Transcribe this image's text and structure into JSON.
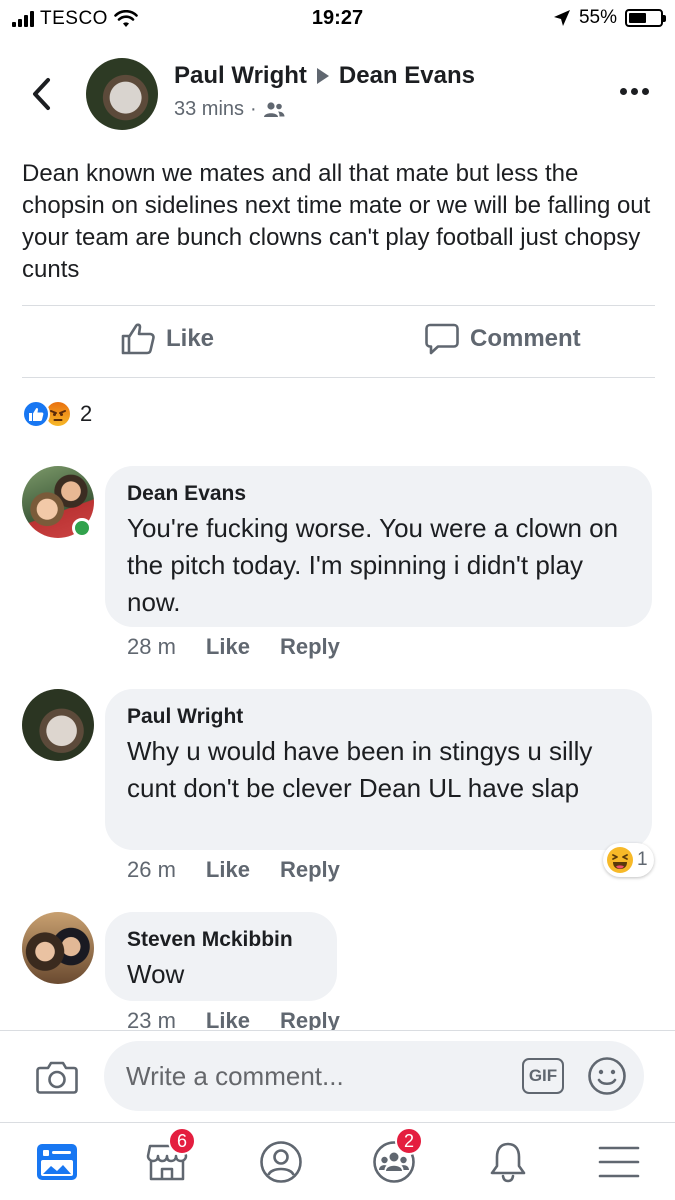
{
  "status_bar": {
    "carrier": "TESCO",
    "time": "19:27",
    "battery_percent": "55%",
    "battery_level": 0.55
  },
  "post": {
    "author": "Paul Wright",
    "target": "Dean Evans",
    "time": "33 mins",
    "separator": "·",
    "audience_icon": "friends-icon",
    "text": "Dean known we mates and all that mate but less the chopsin on sidelines next time mate or we will be falling out your team are bunch clowns can't play football just chopsy cunts",
    "like_label": "Like",
    "comment_label": "Comment",
    "reaction_count": "2",
    "reaction_icons": [
      "like-reaction-icon",
      "angry-reaction-icon"
    ]
  },
  "comments": [
    {
      "author": "Dean Evans",
      "text": "You're fucking worse. You were a clown on the pitch today. I'm spinning i didn't play now.",
      "time": "28 m",
      "like": "Like",
      "reply": "Reply",
      "online": true
    },
    {
      "author": "Paul Wright",
      "text": "Why u would have been in stingys u silly cunt don't be clever Dean UL have slap",
      "time": "26 m",
      "like": "Like",
      "reply": "Reply",
      "reaction_count": "1",
      "reaction_icon": "haha-reaction-icon"
    },
    {
      "author": "Steven Mckibbin",
      "text": "Wow",
      "time": "23 m",
      "like": "Like",
      "reply": "Reply"
    }
  ],
  "composer": {
    "placeholder": "Write a comment...",
    "gif_label": "GIF"
  },
  "tabbar": {
    "items": [
      {
        "icon": "news-feed-icon",
        "active": true
      },
      {
        "icon": "marketplace-icon",
        "badge": "6"
      },
      {
        "icon": "profile-icon"
      },
      {
        "icon": "groups-icon",
        "badge": "2"
      },
      {
        "icon": "notifications-bell-icon"
      },
      {
        "icon": "menu-icon"
      }
    ]
  },
  "colors": {
    "accent": "#1877f2",
    "badge": "#e41e3f",
    "online": "#31a24c",
    "bubble": "#f0f2f5",
    "secondary_text": "#606770"
  }
}
